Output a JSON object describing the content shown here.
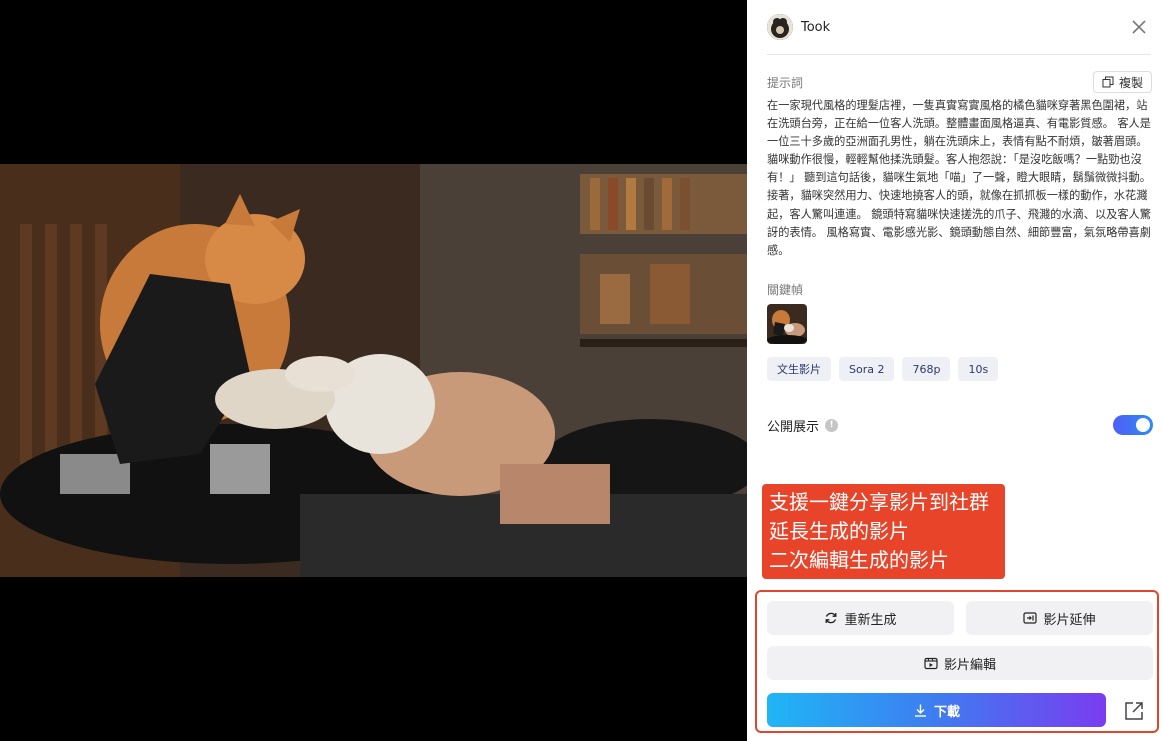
{
  "user": {
    "name": "Took"
  },
  "prompt": {
    "label": "提示詞",
    "copy_label": "複製",
    "text": "在一家現代風格的理髮店裡，一隻真實寫實風格的橘色貓咪穿著黑色圍裙，站在洗頭台旁，正在給一位客人洗頭。整體畫面風格逼真、有電影質感。 客人是一位三十多歲的亞洲面孔男性，躺在洗頭床上，表情有點不耐煩，皺著眉頭。 貓咪動作很慢，輕輕幫他揉洗頭髮。客人抱怨說：「是沒吃飯嗎？一點勁也沒有！」 聽到這句話後，貓咪生氣地「喵」了一聲，瞪大眼睛，鬍鬚微微抖動。 接著，貓咪突然用力、快速地撓客人的頭，就像在抓抓板一樣的動作，水花濺起，客人驚叫連連。 鏡頭特寫貓咪快速搓洗的爪子、飛濺的水滴、以及客人驚訝的表情。 風格寫實、電影感光影、鏡頭動態自然、細節豐富，氣氛略帶喜劇感。"
  },
  "keyframe": {
    "label": "關鍵幀"
  },
  "tags": [
    "文生影片",
    "Sora 2",
    "768p",
    "10s"
  ],
  "public": {
    "label": "公開展示",
    "enabled": true
  },
  "annotation": {
    "lines": [
      "支援一鍵分享影片到社群",
      "延長生成的影片",
      "二次編輯生成的影片"
    ],
    "color": "#e8442a"
  },
  "actions": {
    "regenerate": "重新生成",
    "extend": "影片延伸",
    "edit": "影片編輯",
    "download": "下載"
  },
  "icons": {
    "close": "close-icon",
    "copy": "copy-icon",
    "info": "info-icon",
    "regenerate": "refresh-icon",
    "extend": "extend-icon",
    "edit": "video-edit-icon",
    "download": "download-icon",
    "share": "share-external-icon"
  }
}
